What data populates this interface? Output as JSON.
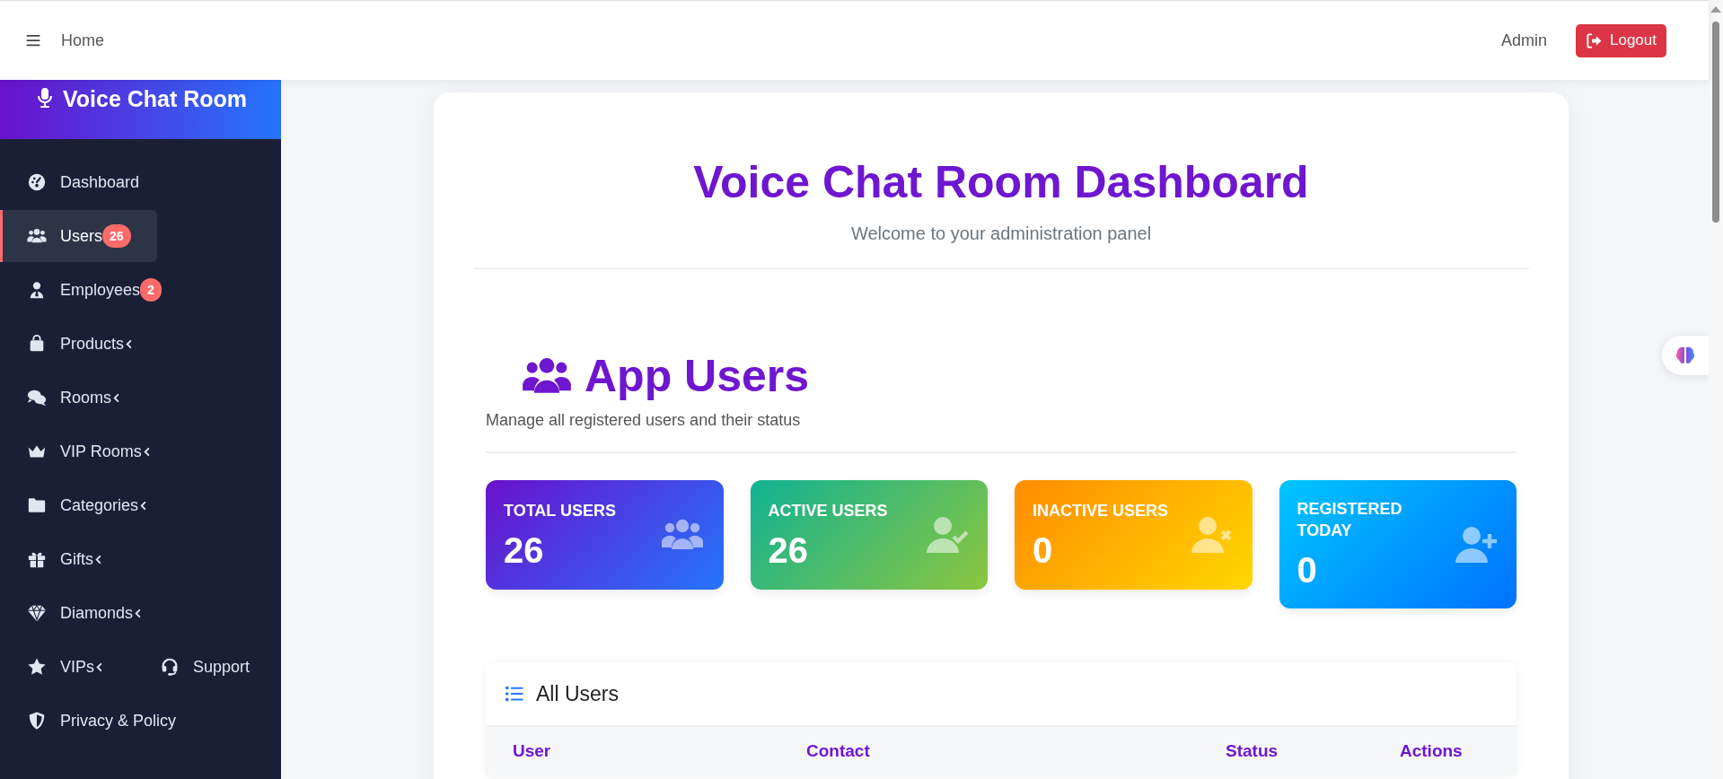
{
  "header": {
    "breadcrumb": "Home",
    "user": "Admin",
    "logout": "Logout"
  },
  "sidebar": {
    "brand": "Voice Chat Room",
    "items": [
      {
        "label": "Dashboard",
        "selected": false,
        "caret": false
      },
      {
        "label": "Users",
        "selected": true,
        "badge": "26",
        "caret": false
      },
      {
        "label": "Employees",
        "selected": false,
        "badge": "2",
        "caret": false
      },
      {
        "label": "Products",
        "selected": false,
        "caret": true
      },
      {
        "label": "Rooms",
        "selected": false,
        "caret": true
      },
      {
        "label": "VIP Rooms",
        "selected": false,
        "caret": true
      },
      {
        "label": "Categories",
        "selected": false,
        "caret": true
      },
      {
        "label": "Gifts",
        "selected": false,
        "caret": true
      },
      {
        "label": "Diamonds",
        "selected": false,
        "caret": true
      },
      {
        "label": "VIPs",
        "selected": false,
        "caret": true,
        "aside": {
          "label": "Support"
        }
      },
      {
        "label": "Privacy & Policy",
        "selected": false,
        "caret": false
      }
    ]
  },
  "main": {
    "title": "Voice Chat Room Dashboard",
    "subtitle": "Welcome to your administration panel",
    "section": {
      "title": "App Users",
      "description": "Manage all registered users and their status"
    },
    "stats": [
      {
        "kind": "total",
        "label": "TOTAL USERS",
        "value": "26"
      },
      {
        "kind": "active",
        "label": "ACTIVE USERS",
        "value": "26"
      },
      {
        "kind": "inactive",
        "label": "INACTIVE USERS",
        "value": "0"
      },
      {
        "kind": "registered",
        "label": "REGISTERED TODAY",
        "value": "0"
      }
    ],
    "table": {
      "title": "All Users",
      "columns": [
        "User",
        "Contact",
        "Status",
        "Actions"
      ]
    }
  }
}
